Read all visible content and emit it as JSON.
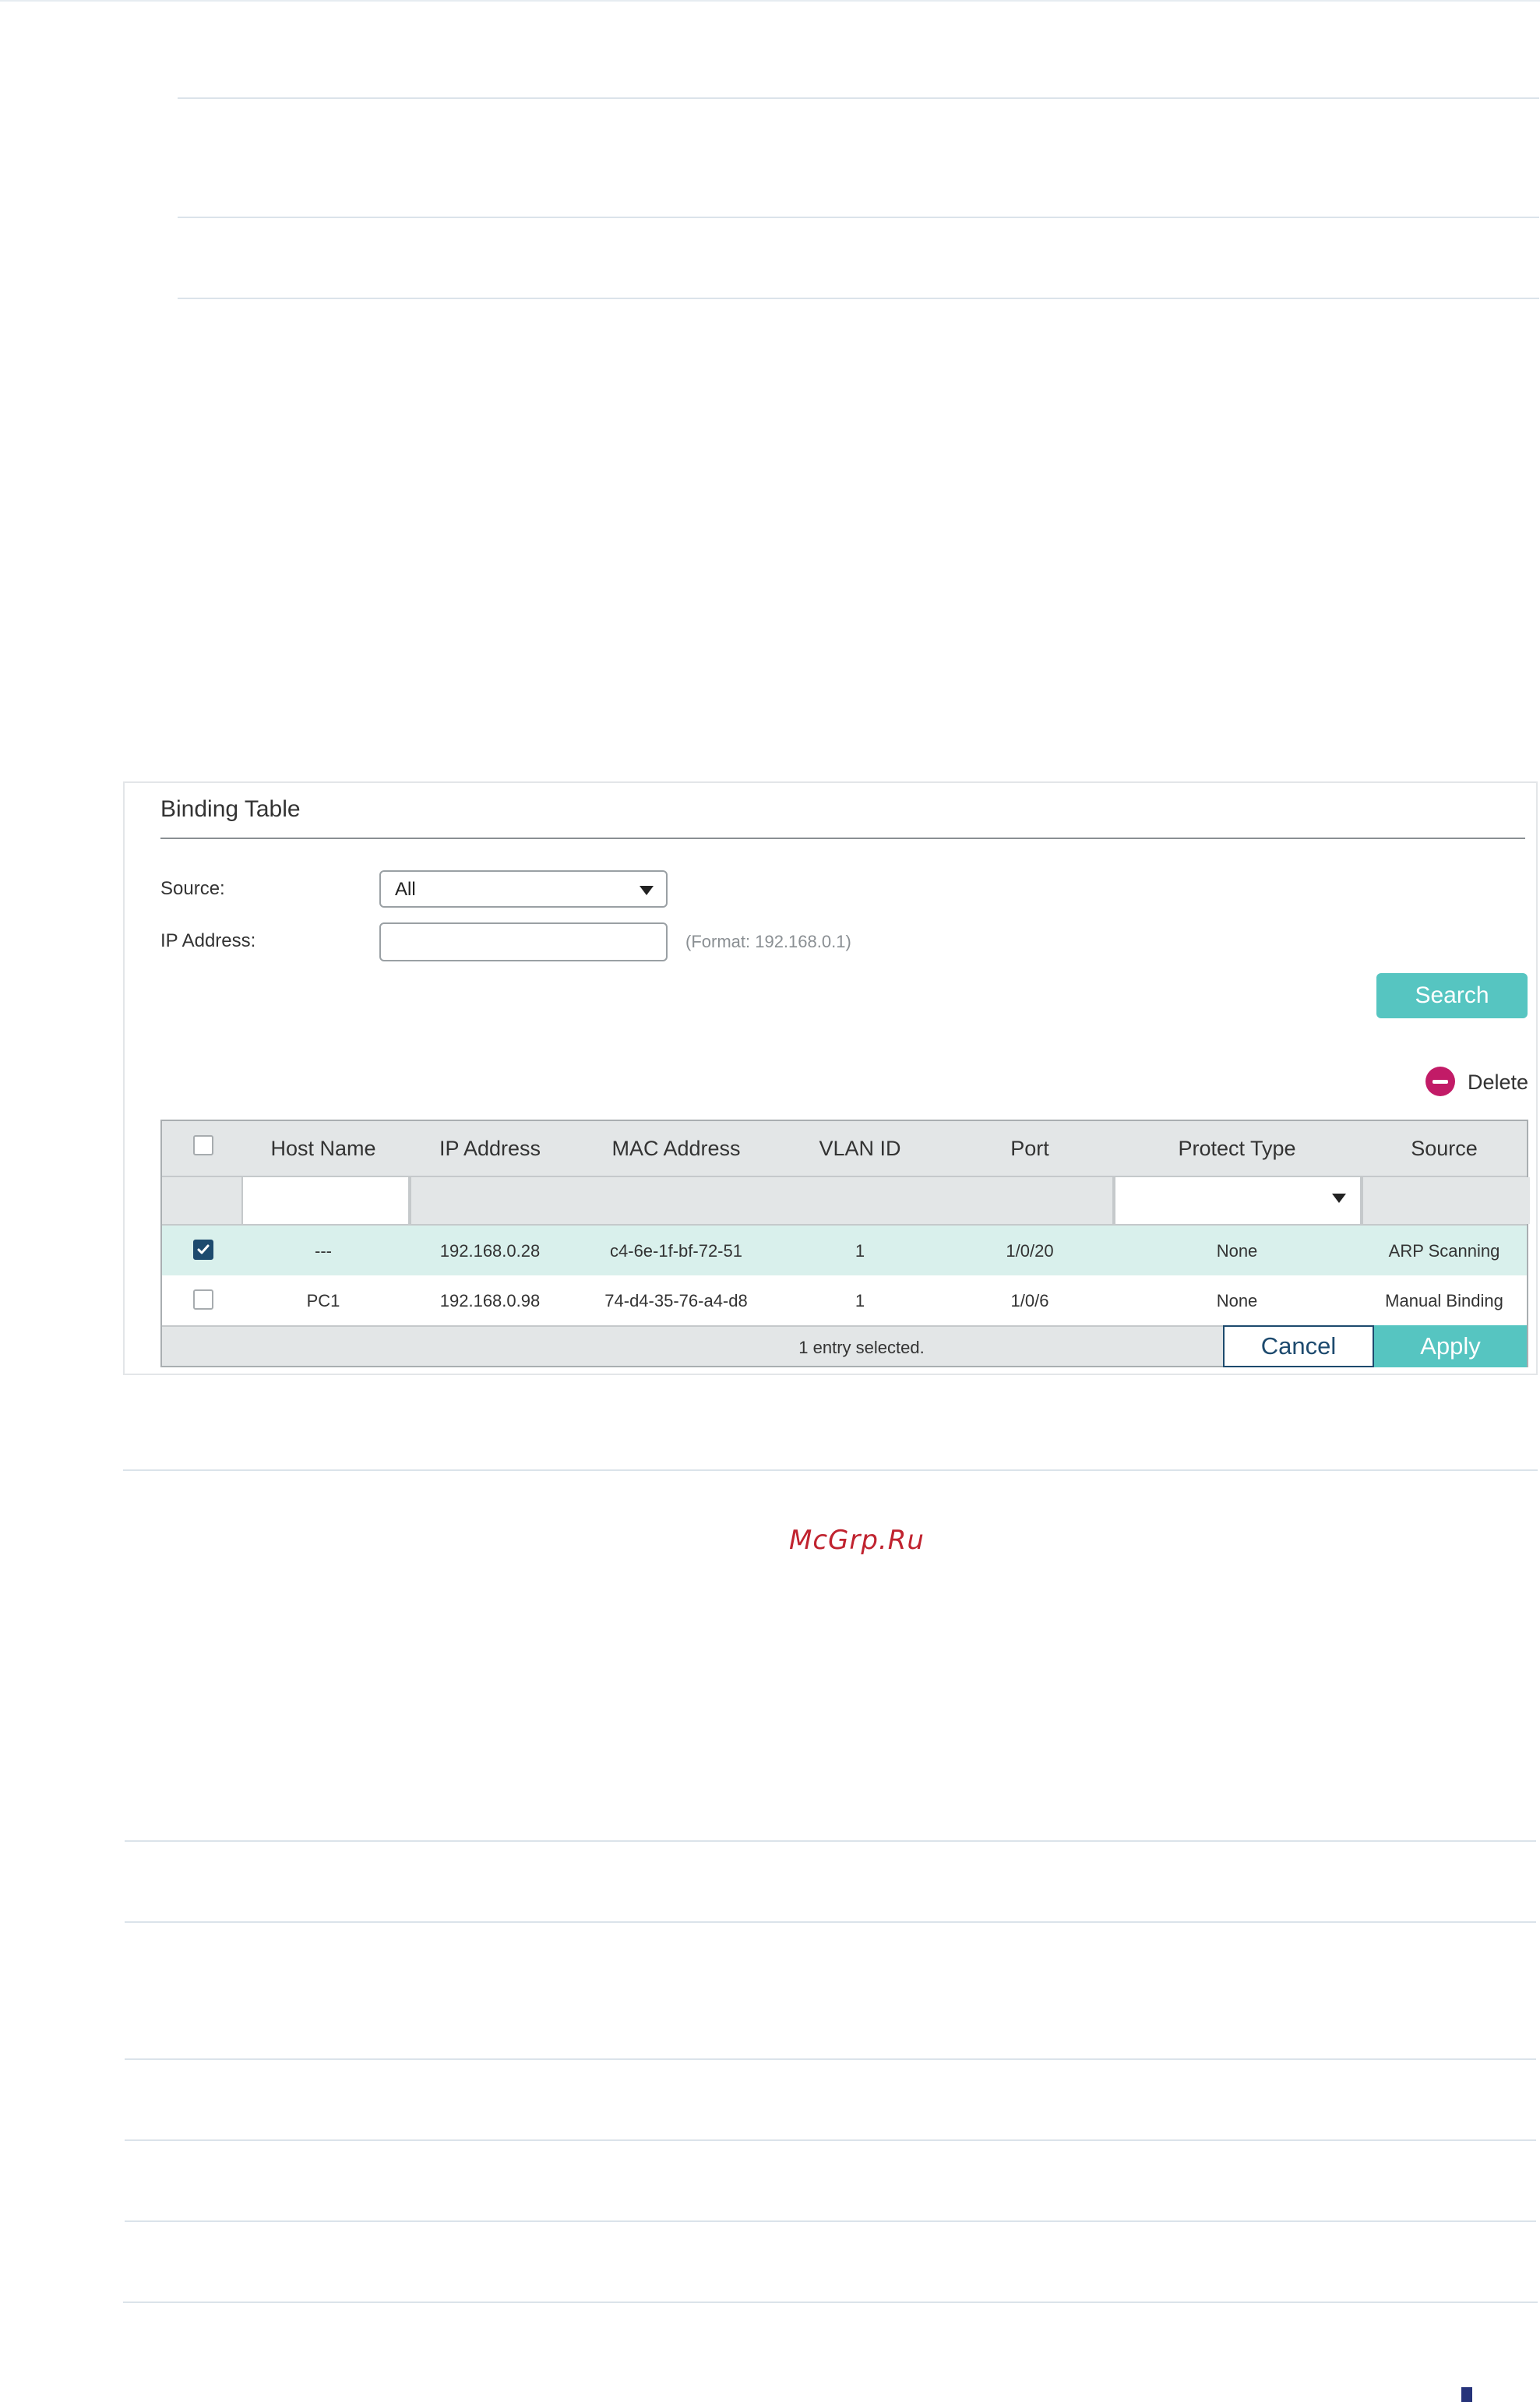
{
  "panel": {
    "title": "Binding Table",
    "form": {
      "source_label": "Source:",
      "source_value": "All",
      "ip_label": "IP Address:",
      "ip_value": "",
      "ip_hint": "(Format: 192.168.0.1)"
    },
    "search_label": "Search",
    "delete_label": "Delete",
    "table": {
      "columns": [
        "Host Name",
        "IP Address",
        "MAC Address",
        "VLAN ID",
        "Port",
        "Protect Type",
        "Source"
      ],
      "rows": [
        {
          "checked": true,
          "host_name": "---",
          "ip": "192.168.0.28",
          "mac": "c4-6e-1f-bf-72-51",
          "vlan": "1",
          "port": "1/0/20",
          "protect_type": "None",
          "source": "ARP Scanning"
        },
        {
          "checked": false,
          "host_name": "PC1",
          "ip": "192.168.0.98",
          "mac": "74-d4-35-76-a4-d8",
          "vlan": "1",
          "port": "1/0/6",
          "protect_type": "None",
          "source": "Manual Binding"
        }
      ],
      "footer_status": "1 entry selected.",
      "cancel_label": "Cancel",
      "apply_label": "Apply"
    },
    "watermark": "McGrp.Ru"
  },
  "colors": {
    "accent": "#56c5c1",
    "selected_row": "#d9f0ec",
    "delete_icon": "#c21b67",
    "checkbox_checked": "#1d4a6e"
  }
}
